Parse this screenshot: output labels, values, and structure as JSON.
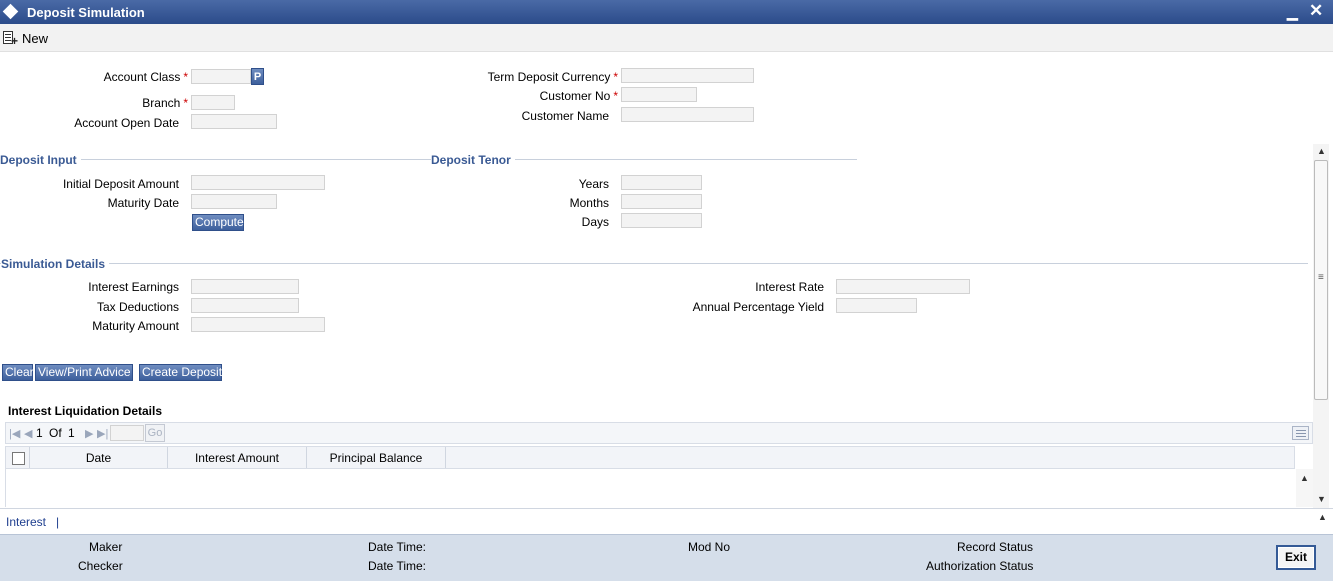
{
  "window": {
    "title": "Deposit Simulation"
  },
  "toolbar": {
    "new_label": "New"
  },
  "form": {
    "account_class": {
      "label": "Account Class",
      "value": "",
      "lov_button": "P"
    },
    "branch": {
      "label": "Branch",
      "value": ""
    },
    "account_open_date": {
      "label": "Account Open Date",
      "value": ""
    },
    "term_deposit_currency": {
      "label": "Term Deposit Currency",
      "value": ""
    },
    "customer_no": {
      "label": "Customer No",
      "value": ""
    },
    "customer_name": {
      "label": "Customer Name",
      "value": ""
    },
    "required_mark": "*"
  },
  "deposit_input": {
    "title": "Deposit Input",
    "initial_deposit_amount": {
      "label": "Initial Deposit Amount",
      "value": ""
    },
    "maturity_date": {
      "label": "Maturity Date",
      "value": ""
    },
    "compute_label": "Compute"
  },
  "deposit_tenor": {
    "title": "Deposit Tenor",
    "years": {
      "label": "Years",
      "value": ""
    },
    "months": {
      "label": "Months",
      "value": ""
    },
    "days": {
      "label": "Days",
      "value": ""
    }
  },
  "simulation": {
    "title": "Simulation Details",
    "interest_earnings": {
      "label": "Interest Earnings",
      "value": ""
    },
    "tax_deductions": {
      "label": "Tax Deductions",
      "value": ""
    },
    "maturity_amount": {
      "label": "Maturity Amount",
      "value": ""
    },
    "interest_rate": {
      "label": "Interest Rate",
      "value": ""
    },
    "annual_percentage_yield": {
      "label": "Annual Percentage Yield",
      "value": ""
    }
  },
  "actions": {
    "clear": "Clear",
    "view_print_advice": "View/Print Advice",
    "create_deposit": "Create Deposit"
  },
  "grid": {
    "title": "Interest Liquidation Details",
    "page_current": "1",
    "page_of": "Of",
    "page_total": "1",
    "go_label": "Go",
    "columns": [
      "Date",
      "Interest Amount",
      "Principal Balance"
    ],
    "rows": []
  },
  "tabs": {
    "interest": "Interest",
    "separator": "|"
  },
  "footer": {
    "maker_label": "Maker",
    "checker_label": "Checker",
    "date_time_label": "Date Time:",
    "mod_no_label": "Mod No",
    "record_status_label": "Record Status",
    "authorization_status_label": "Authorization Status",
    "exit_label": "Exit"
  }
}
